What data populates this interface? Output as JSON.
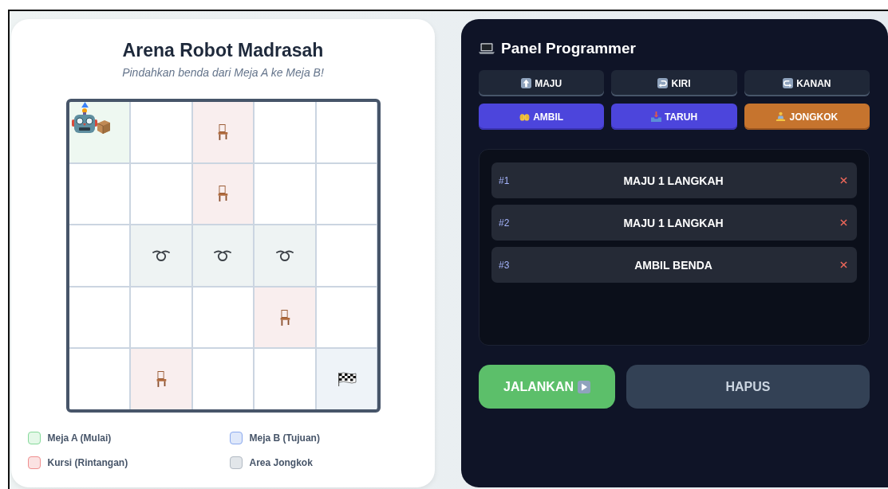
{
  "arena": {
    "title": "Arena Robot Madrasah",
    "subtitle": "Pindahkan benda dari Meja A ke Meja B!",
    "grid": [
      [
        {
          "kind": "start",
          "robot": {
            "carrying": true
          }
        },
        {
          "kind": "empty"
        },
        {
          "kind": "chair"
        },
        {
          "kind": "empty"
        },
        {
          "kind": "empty"
        }
      ],
      [
        {
          "kind": "empty"
        },
        {
          "kind": "empty"
        },
        {
          "kind": "chair"
        },
        {
          "kind": "empty"
        },
        {
          "kind": "empty"
        }
      ],
      [
        {
          "kind": "empty"
        },
        {
          "kind": "squat"
        },
        {
          "kind": "squat"
        },
        {
          "kind": "squat"
        },
        {
          "kind": "empty"
        }
      ],
      [
        {
          "kind": "empty"
        },
        {
          "kind": "empty"
        },
        {
          "kind": "empty"
        },
        {
          "kind": "chair"
        },
        {
          "kind": "empty"
        }
      ],
      [
        {
          "kind": "empty"
        },
        {
          "kind": "chair"
        },
        {
          "kind": "empty"
        },
        {
          "kind": "empty"
        },
        {
          "kind": "goal"
        }
      ]
    ],
    "legend": [
      {
        "kind": "start",
        "label": "Meja A (Mulai)"
      },
      {
        "kind": "goal",
        "label": "Meja B (Tujuan)"
      },
      {
        "kind": "chair",
        "label": "Kursi (Rintangan)"
      },
      {
        "kind": "squat",
        "label": "Area Jongkok"
      }
    ]
  },
  "panel": {
    "title": "Panel Programmer",
    "commands": [
      {
        "kind": "forward",
        "label": "MAJU"
      },
      {
        "kind": "turn-left",
        "label": "KIRI"
      },
      {
        "kind": "turn-right",
        "label": "KANAN"
      },
      {
        "kind": "pick",
        "label": "AMBIL"
      },
      {
        "kind": "place",
        "label": "TARUH"
      },
      {
        "kind": "squat",
        "label": "JONGKOK"
      }
    ],
    "program": [
      {
        "number": "#1",
        "text": "MAJU 1 LANGKAH"
      },
      {
        "number": "#2",
        "text": "MAJU 1 LANGKAH"
      },
      {
        "number": "#3",
        "text": "AMBIL BENDA"
      }
    ],
    "run_button": "JALANKAN",
    "clear_button": "HAPUS"
  }
}
